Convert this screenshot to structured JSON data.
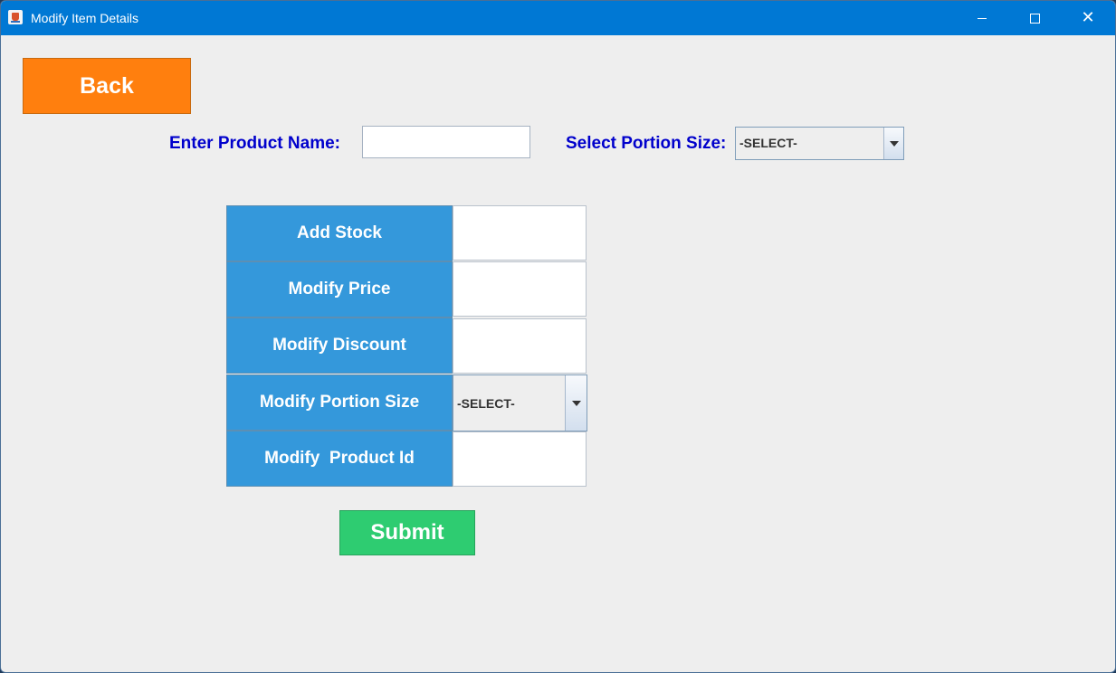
{
  "window": {
    "title": "Modify Item Details",
    "controls": {
      "minimize": "minimize",
      "maximize": "maximize",
      "close": "✕"
    }
  },
  "header": {
    "back_label": "Back",
    "product_name_label": "Enter Product Name:",
    "product_name_value": "",
    "portion_size_label": "Select Portion Size:",
    "portion_size_selected": "-SELECT-"
  },
  "form": {
    "rows": [
      {
        "label": "Add Stock",
        "value": ""
      },
      {
        "label": "Modify Price",
        "value": ""
      },
      {
        "label": "Modify Discount",
        "value": ""
      },
      {
        "label": "Modify Portion Size",
        "selected": "-SELECT-"
      },
      {
        "label": "Modify  Product Id",
        "value": ""
      }
    ],
    "submit_label": "Submit"
  },
  "colors": {
    "title_bar": "#0078d4",
    "back_button": "#ff7f0e",
    "row_label_bg": "#3498db",
    "submit_button": "#2ecc71",
    "label_text": "#0000cc",
    "window_bg": "#eeeeee"
  },
  "icons": {
    "app": "java-cup-icon",
    "dropdown": "caret-down-icon"
  }
}
